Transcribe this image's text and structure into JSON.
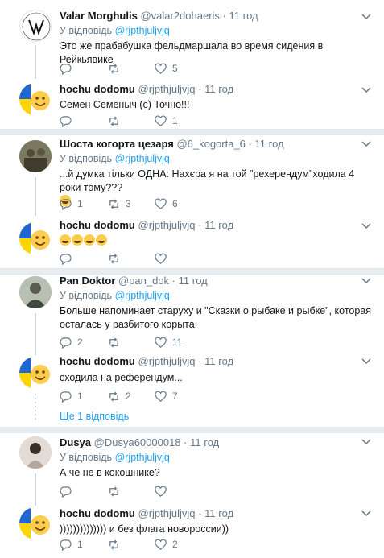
{
  "tweets": [
    {
      "name": "Valar Morghulis",
      "handle": "@valar2dohaeris",
      "dot": "·",
      "time": "11 год",
      "reply_prefix": "У відповідь",
      "reply_to": "@rjpthjuljvjq",
      "text": "Это же прабабушка фельдмаршала во время сидения в Рейкьявике",
      "replies": "",
      "retweets": "",
      "likes": "5",
      "avatar_text": "VALAR MORGHULIS VALAR DOHAERIS"
    },
    {
      "name": "hochu dodomu",
      "handle": "@rjpthjuljvjq",
      "dot": "·",
      "time": "11 год",
      "text": "Семен Семеныч (с) Точно!!!",
      "replies": "",
      "retweets": "",
      "likes": "1"
    },
    {
      "name": "Шоста когорта цезаря",
      "handle": "@6_kogorta_6",
      "dot": "·",
      "time": "11 год",
      "reply_prefix": "У відповідь",
      "reply_to": "@rjpthjuljvjq",
      "text": "...й думка тільки ОДНА: Нахєра я на той \"рехерендум\"ходила 4 роки тому???",
      "replies": "1",
      "retweets": "3",
      "likes": "6"
    },
    {
      "name": "hochu dodomu",
      "handle": "@rjpthjuljvjq",
      "dot": "·",
      "time": "11 год",
      "text": "",
      "replies": "",
      "retweets": "",
      "likes": ""
    },
    {
      "name": "Pan Doktor",
      "handle": "@pan_dok",
      "dot": "·",
      "time": "11 год",
      "reply_prefix": "У відповідь",
      "reply_to": "@rjpthjuljvjq",
      "text": "Больше напоминает старуху и \"Сказки о рыбаке и рыбке\", которая осталась у разбитого корыта.",
      "replies": "2",
      "retweets": "",
      "likes": "11"
    },
    {
      "name": "hochu dodomu",
      "handle": "@rjpthjuljvjq",
      "dot": "·",
      "time": "11 год",
      "text": "сходила на референдум...",
      "replies": "1",
      "retweets": "2",
      "likes": "7"
    },
    {
      "name": "Dusya",
      "handle": "@Dusya60000018",
      "dot": "·",
      "time": "11 год",
      "reply_prefix": "У відповідь",
      "reply_to": "@rjpthjuljvjq",
      "text": "А че не в кокошнике?",
      "replies": "",
      "retweets": "",
      "likes": ""
    },
    {
      "name": "hochu dodomu",
      "handle": "@rjpthjuljvjq",
      "dot": "·",
      "time": "11 год",
      "text": ")))))))))))))) и без флага новороссии))",
      "replies": "1",
      "retweets": "",
      "likes": "2"
    }
  ],
  "show_more": "Ще 1 відповідь",
  "colors": {
    "accent": "#1da1f2",
    "muted": "#657786",
    "divider": "#e6ecf0"
  }
}
